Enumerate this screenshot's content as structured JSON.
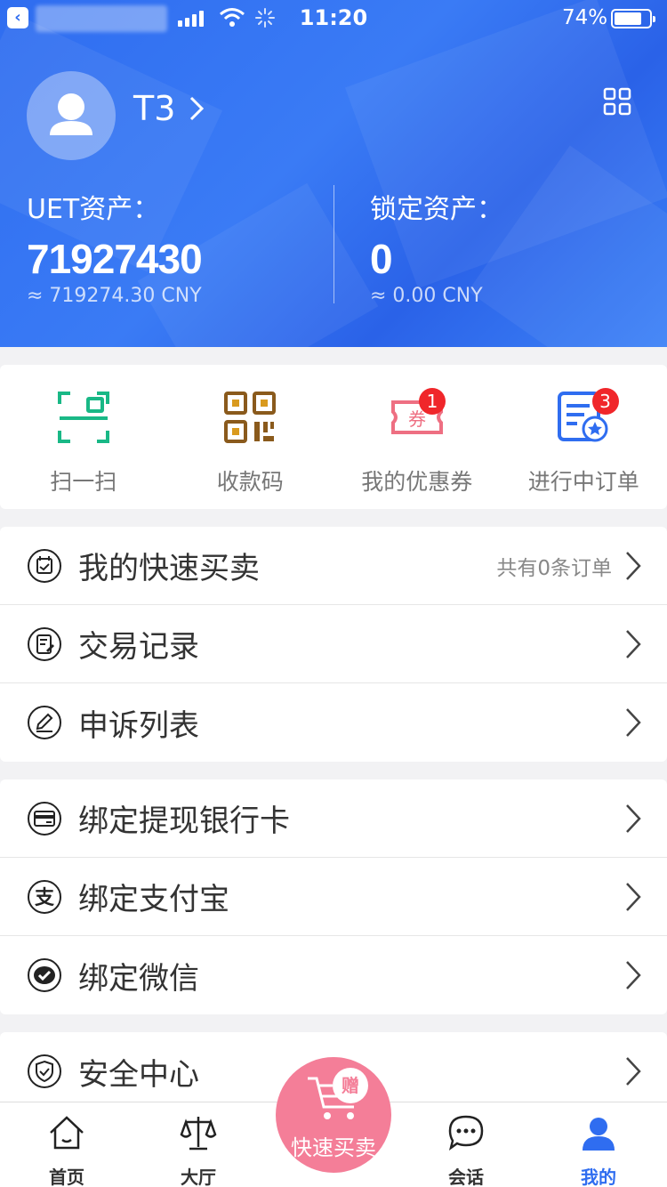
{
  "status_bar": {
    "time": "11:20",
    "battery": "74%"
  },
  "profile": {
    "username": "T3",
    "chevron": "›"
  },
  "assets": {
    "uet": {
      "label": "UET资产：",
      "amount": "71927430",
      "cny": "≈ 719274.30 CNY"
    },
    "locked": {
      "label": "锁定资产：",
      "amount": "0",
      "cny": "≈ 0.00 CNY"
    }
  },
  "quick_actions": [
    {
      "label": "扫一扫",
      "icon": "scan-icon",
      "color": "#19b886"
    },
    {
      "label": "收款码",
      "icon": "qr-code-icon",
      "color": "#8a5a1c"
    },
    {
      "label": "我的优惠券",
      "icon": "coupon-icon",
      "color": "#ee6f82",
      "badge": "1",
      "icon_text": "券"
    },
    {
      "label": "进行中订单",
      "icon": "order-icon",
      "color": "#2f6df0",
      "badge": "3"
    }
  ],
  "group1": [
    {
      "label": "我的快速买卖",
      "icon": "calendar-check-icon",
      "extra": "共有0条订单"
    },
    {
      "label": "交易记录",
      "icon": "record-icon"
    },
    {
      "label": "申诉列表",
      "icon": "pen-icon"
    }
  ],
  "group2": [
    {
      "label": "绑定提现银行卡",
      "icon": "bank-card-icon"
    },
    {
      "label": "绑定支付宝",
      "icon": "alipay-icon",
      "icon_text": "支"
    },
    {
      "label": "绑定微信",
      "icon": "wechat-check-icon"
    }
  ],
  "group3": [
    {
      "label": "安全中心",
      "icon": "shield-icon"
    }
  ],
  "tabbar": {
    "tabs": [
      {
        "label": "首页",
        "icon": "home-icon"
      },
      {
        "label": "大厅",
        "icon": "scale-icon"
      },
      {
        "label": "会话",
        "icon": "chat-icon"
      },
      {
        "label": "我的",
        "icon": "user-icon",
        "active": true
      }
    ],
    "center": {
      "label": "快速买卖",
      "badge": "赠",
      "icon": "cart-icon"
    }
  },
  "colors": {
    "header_blue": "#2f6df0",
    "accent_pink": "#f47e98",
    "badge_red": "#f0262a"
  }
}
